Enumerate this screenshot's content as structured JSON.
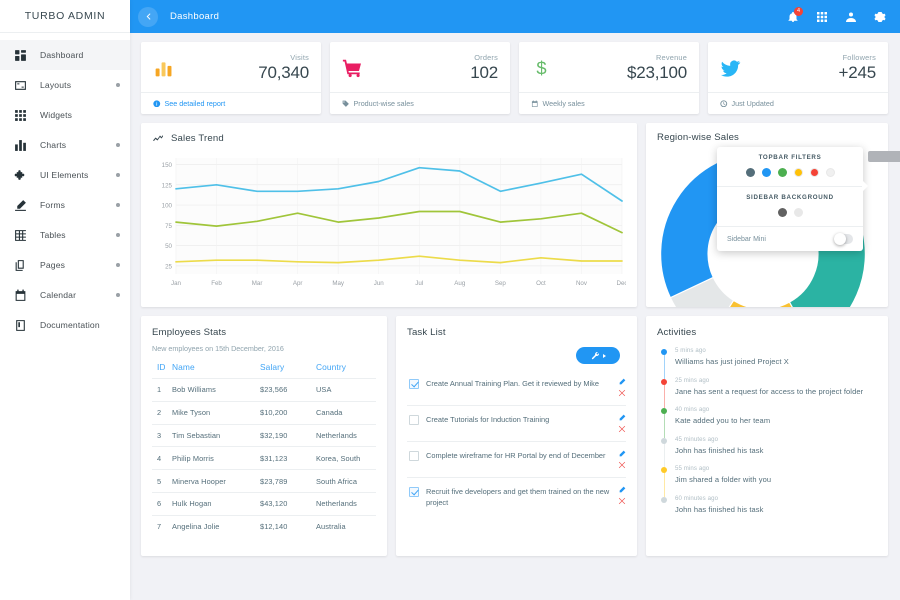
{
  "sidebar": {
    "brand": "TURBO ADMIN",
    "items": [
      {
        "label": "Dashboard",
        "icon": "dashboard-icon",
        "caret": false,
        "active": true
      },
      {
        "label": "Layouts",
        "icon": "layouts-icon",
        "caret": true,
        "active": false
      },
      {
        "label": "Widgets",
        "icon": "widgets-icon",
        "caret": false,
        "active": false
      },
      {
        "label": "Charts",
        "icon": "charts-icon",
        "caret": true,
        "active": false
      },
      {
        "label": "UI Elements",
        "icon": "puzzle-icon",
        "caret": true,
        "active": false
      },
      {
        "label": "Forms",
        "icon": "pencil-icon",
        "caret": true,
        "active": false
      },
      {
        "label": "Tables",
        "icon": "table-icon",
        "caret": true,
        "active": false
      },
      {
        "label": "Pages",
        "icon": "pages-icon",
        "caret": true,
        "active": false
      },
      {
        "label": "Calendar",
        "icon": "calendar-icon",
        "caret": true,
        "active": false
      },
      {
        "label": "Documentation",
        "icon": "book-icon",
        "caret": false,
        "active": false
      }
    ]
  },
  "topbar": {
    "title": "Dashboard",
    "back_icon": "chevron-left-icon",
    "accent_color": "#2196f3",
    "notification_count": "4",
    "icons": [
      "bell-icon",
      "apps-grid-icon",
      "user-icon",
      "gear-icon"
    ]
  },
  "stats": [
    {
      "label": "Visits",
      "value": "70,340",
      "icon": "bar-chart-icon",
      "icon_color": "#f6a623",
      "foot_text": "See detailed report",
      "foot_icon": "info-icon",
      "foot_icon_color": "#2196f3",
      "foot_text_color": "#2196f3"
    },
    {
      "label": "Orders",
      "value": "102",
      "icon": "shopping-cart-icon",
      "icon_color": "#e91e63",
      "foot_text": "Product-wise sales",
      "foot_icon": "tag-icon",
      "foot_icon_color": "#78909c",
      "foot_text_color": "#78909c"
    },
    {
      "label": "Revenue",
      "value": "$23,100",
      "icon": "dollar-icon",
      "icon_color": "#66bb6a",
      "foot_text": "Weekly sales",
      "foot_icon": "calendar-icon",
      "foot_icon_color": "#78909c",
      "foot_text_color": "#78909c"
    },
    {
      "label": "Followers",
      "value": "+245",
      "icon": "twitter-icon",
      "icon_color": "#29b6f6",
      "foot_text": "Just Updated",
      "foot_icon": "clock-icon",
      "foot_icon_color": "#78909c",
      "foot_text_color": "#78909c"
    }
  ],
  "sales_card": {
    "title": "Sales Trend",
    "icon": "trend-line-icon"
  },
  "region_card": {
    "title": "Region-wise Sales",
    "icon": "donut-icon"
  },
  "theme_panel": {
    "topbar_title": "TOPBAR FILTERS",
    "topbar_colors": [
      "#546e7a",
      "#2196f3",
      "#4caf50",
      "#ffc107",
      "#f44336",
      "#f0f0f0"
    ],
    "sidebar_title": "SIDEBAR BACKGROUND",
    "sidebar_colors": [
      "#616161",
      "#e8e8e8"
    ],
    "toggle_label": "Sidebar Mini",
    "toggle_on": false
  },
  "employees": {
    "title": "Employees Stats",
    "subtitle": "New employees on 15th December, 2016",
    "columns": [
      "ID",
      "Name",
      "Salary",
      "Country"
    ],
    "rows": [
      [
        "1",
        "Bob Williams",
        "$23,566",
        "USA"
      ],
      [
        "2",
        "Mike Tyson",
        "$10,200",
        "Canada"
      ],
      [
        "3",
        "Tim Sebastian",
        "$32,190",
        "Netherlands"
      ],
      [
        "4",
        "Philip Morris",
        "$31,123",
        "Korea, South"
      ],
      [
        "5",
        "Minerva Hooper",
        "$23,789",
        "South Africa"
      ],
      [
        "6",
        "Hulk Hogan",
        "$43,120",
        "Netherlands"
      ],
      [
        "7",
        "Angelina Jolie",
        "$12,140",
        "Australia"
      ]
    ]
  },
  "tasks": {
    "title": "Task List",
    "action_icon": "wrench-icon",
    "items": [
      {
        "text": "Create Annual Training Plan. Get it reviewed by Mike",
        "done": true
      },
      {
        "text": "Create Tutorials for Induction Training",
        "done": false
      },
      {
        "text": "Complete wireframe for HR Portal by end of December",
        "done": false
      },
      {
        "text": "Recruit five developers and get them trained on the new project",
        "done": true
      }
    ],
    "edit_icon": "pencil-icon",
    "delete_icon": "close-x-icon"
  },
  "activities": {
    "title": "Activities",
    "items": [
      {
        "time": "5 mins ago",
        "text": "Williams has just joined Project X",
        "color": "#2196f3"
      },
      {
        "time": "25 mins ago",
        "text": "Jane has sent a request for access to the project folder",
        "color": "#f44336"
      },
      {
        "time": "40 mins ago",
        "text": "Kate added you to her team",
        "color": "#4caf50"
      },
      {
        "time": "45 minutes ago",
        "text": "John has finished his task",
        "color": "#cfd8dc"
      },
      {
        "time": "55 mins ago",
        "text": "Jim shared a folder with you",
        "color": "#ffca28"
      },
      {
        "time": "60 minutes ago",
        "text": "John has finished his task",
        "color": "#cfd8dc"
      }
    ]
  },
  "chart_data": [
    {
      "type": "line",
      "title": "Sales Trend",
      "xlabel": "",
      "ylabel": "",
      "grid": true,
      "legend": "none",
      "x": [
        "Jan",
        "Feb",
        "Mar",
        "Apr",
        "May",
        "Jun",
        "Jul",
        "Aug",
        "Sep",
        "Oct",
        "Nov",
        "Dec"
      ],
      "ylim": [
        15,
        158
      ],
      "yticks": [
        25,
        50,
        75,
        100,
        125,
        150
      ],
      "series": [
        {
          "name": "Series 1",
          "color": "#4fc0e8",
          "values": [
            120,
            125,
            117,
            117,
            120,
            129,
            146,
            142,
            117,
            127,
            138,
            105
          ]
        },
        {
          "name": "Series 2",
          "color": "#a0c53a",
          "values": [
            79,
            74,
            80,
            90,
            79,
            84,
            92,
            92,
            79,
            83,
            90,
            66
          ]
        },
        {
          "name": "Series 3",
          "color": "#ecdb4a",
          "values": [
            30,
            32,
            32,
            30,
            29,
            32,
            37,
            32,
            29,
            35,
            31,
            31
          ]
        }
      ]
    },
    {
      "type": "pie",
      "title": "Region-wise Sales",
      "donut": true,
      "labels": [
        "Teal region",
        "Amber region",
        "Grey region",
        "Blue region"
      ],
      "values": [
        42,
        17,
        9,
        32
      ],
      "colors": [
        "#2bb3a3",
        "#f9c132",
        "#e4e7e8",
        "#2196f3"
      ]
    }
  ]
}
